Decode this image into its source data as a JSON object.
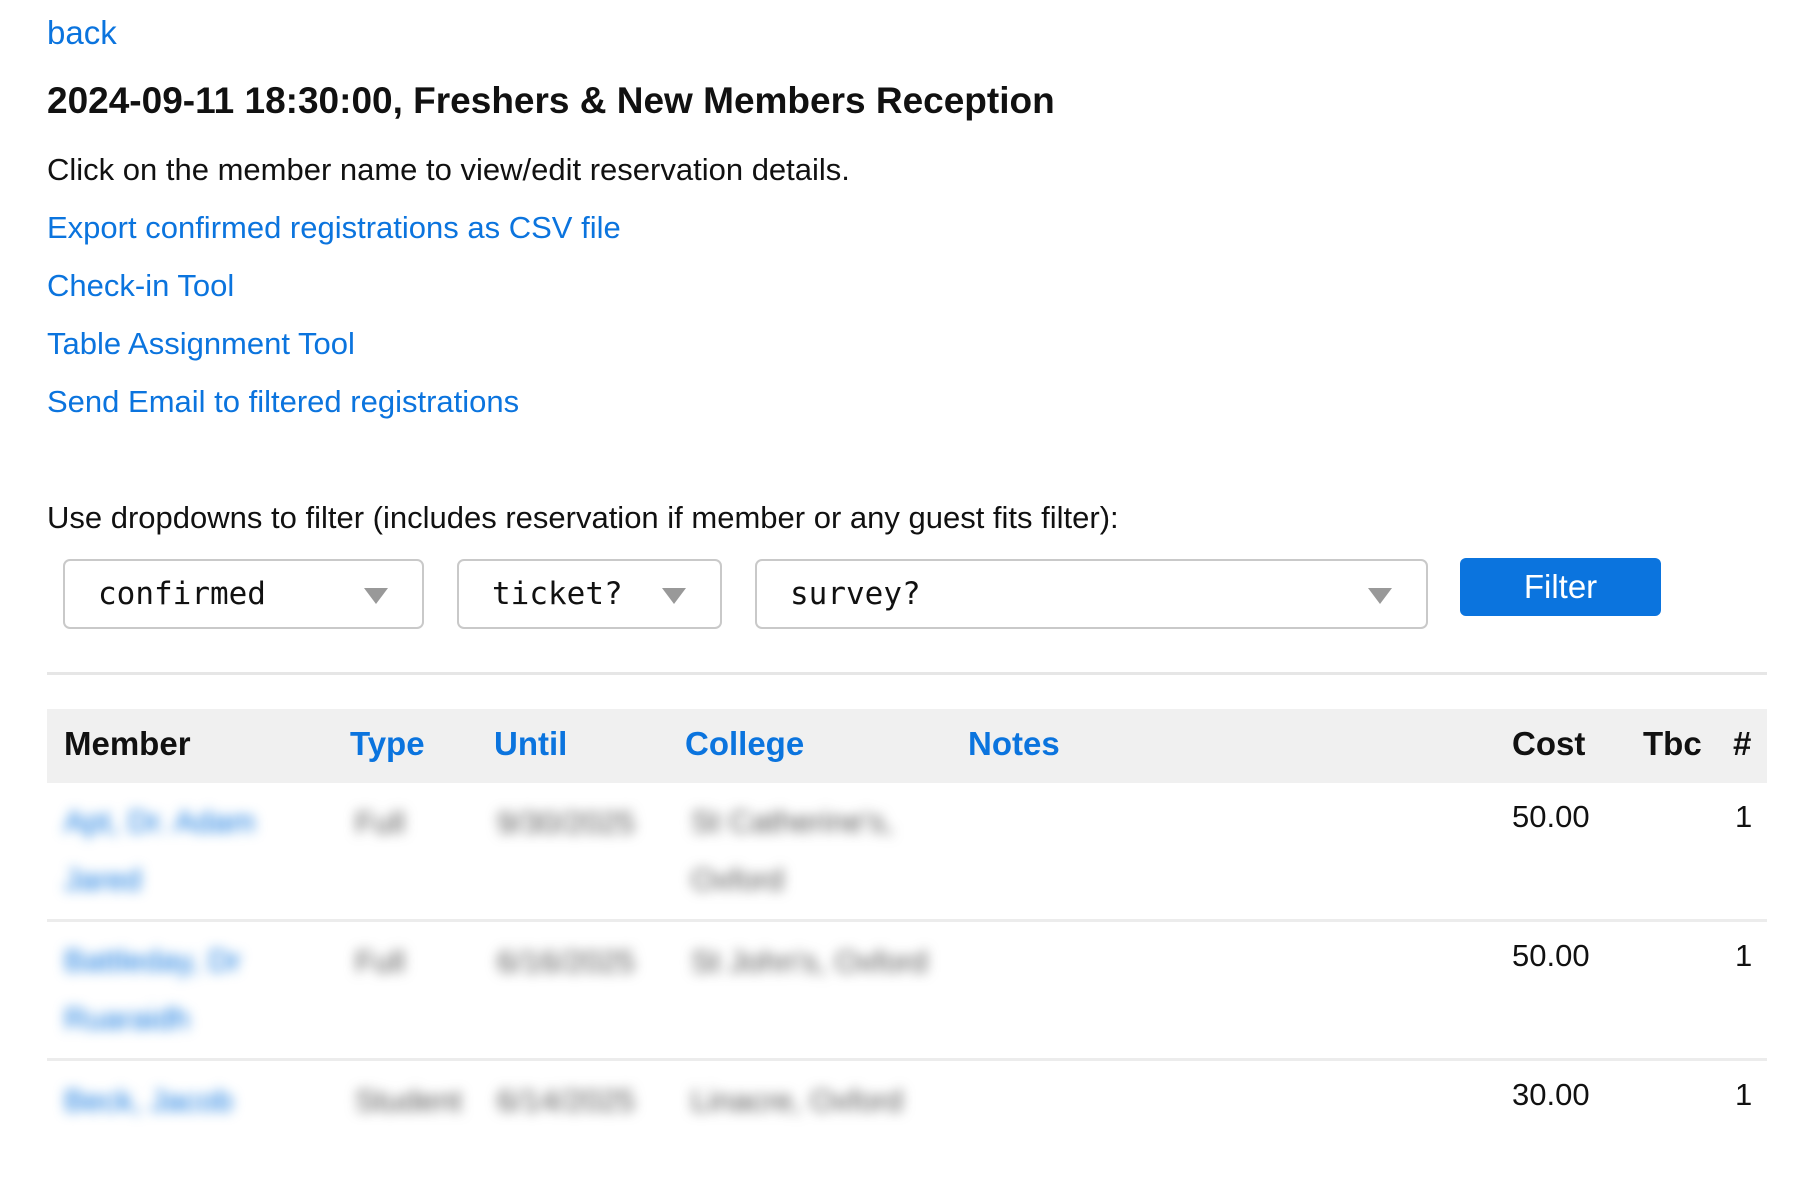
{
  "nav": {
    "back_label": "back"
  },
  "page": {
    "title": "2024-09-11 18:30:00, Freshers & New Members Reception",
    "intro": "Click on the member name to view/edit reservation details."
  },
  "actions": [
    {
      "label": "Export confirmed registrations as CSV file"
    },
    {
      "label": "Check-in Tool"
    },
    {
      "label": "Table Assignment Tool"
    },
    {
      "label": "Send Email to filtered registrations"
    }
  ],
  "filters": {
    "hint": "Use dropdowns to filter (includes reservation if member or any guest fits filter):",
    "status_value": "confirmed",
    "ticket_value": "ticket?",
    "survey_value": "survey?",
    "button_label": "Filter"
  },
  "table": {
    "headers": {
      "member": "Member",
      "type": "Type",
      "until": "Until",
      "college": "College",
      "notes": "Notes",
      "cost": "Cost",
      "tbc": "Tbc",
      "count": "#"
    },
    "rows": [
      {
        "member": "Apt, Dr. Adam Jared",
        "type": "Full",
        "until": "9/30/2025",
        "college": "St Catherine's, Oxford",
        "notes": "",
        "cost": "50.00",
        "tbc": "",
        "count": "1"
      },
      {
        "member": "Battleday, Dr Ruaraidh",
        "type": "Full",
        "until": "6/16/2025",
        "college": "St John's, Oxford",
        "notes": "",
        "cost": "50.00",
        "tbc": "",
        "count": "1"
      },
      {
        "member": "Beck, Jacob",
        "type": "Student",
        "until": "6/14/2025",
        "college": "Linacre, Oxford",
        "notes": "",
        "cost": "30.00",
        "tbc": "",
        "count": "1"
      }
    ]
  },
  "colors": {
    "link": "#0b74de",
    "header_bg": "#f0f0f0",
    "button_bg": "#0b74de"
  }
}
